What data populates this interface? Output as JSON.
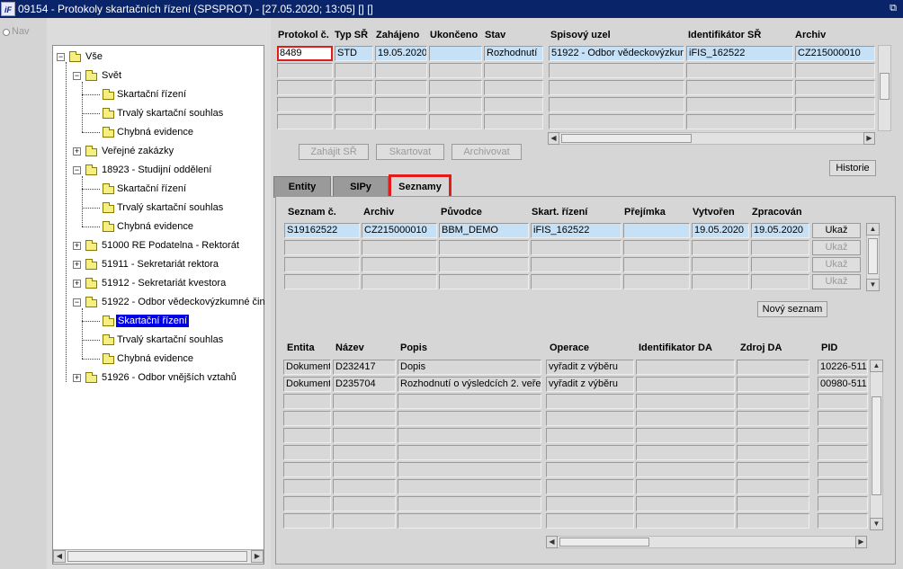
{
  "window": {
    "title": "09154 - Protokoly skartačních řízení (SPSPROT) - [27.05.2020; 13:05] [] []",
    "app_icon": "iF"
  },
  "nav": {
    "label": "Nav"
  },
  "tree": {
    "items": [
      {
        "label": "Vše"
      },
      {
        "label": "Svět"
      },
      {
        "label": "Skartační řízení"
      },
      {
        "label": "Trvalý skartační souhlas"
      },
      {
        "label": "Chybná evidence"
      },
      {
        "label": "Veřejné zakázky"
      },
      {
        "label": "18923 - Studijní oddělení"
      },
      {
        "label": "Skartační řízení"
      },
      {
        "label": "Trvalý skartační souhlas"
      },
      {
        "label": "Chybná evidence"
      },
      {
        "label": "51000 RE Podatelna - Rektorát"
      },
      {
        "label": "51911 - Sekretariát rektora"
      },
      {
        "label": "51912 - Sekretariát kvestora"
      },
      {
        "label": "51922 - Odbor vědeckovýzkumné čin"
      },
      {
        "label": "Skartační řízení"
      },
      {
        "label": "Trvalý skartační souhlas"
      },
      {
        "label": "Chybná evidence"
      },
      {
        "label": "51926 - Odbor vnějších vztahů"
      }
    ]
  },
  "protocol": {
    "headers": {
      "protokol": "Protokol č.",
      "typ": "Typ SŘ",
      "zahajeno": "Zahájeno",
      "ukonceno": "Ukončeno",
      "stav": "Stav",
      "uzel": "Spisový uzel",
      "ident": "Identifikátor SŘ",
      "archiv": "Archiv"
    },
    "row": {
      "protokol": "8489",
      "typ": "STD",
      "zahajeno": "19.05.2020",
      "ukonceno": "",
      "stav": "Rozhodnutí",
      "uzel": "51922 - Odbor vědeckovýzkun",
      "ident": "iFIS_162522",
      "archiv": "CZ215000010"
    }
  },
  "actions": {
    "zahajit": "Zahájit SŘ",
    "skartovat": "Skartovat",
    "archivovat": "Archivovat",
    "historie": "Historie"
  },
  "tabs": {
    "entity": "Entity",
    "sipy": "SIPy",
    "seznamy": "Seznamy"
  },
  "lists": {
    "headers": {
      "seznam": "Seznam č.",
      "archiv": "Archiv",
      "puvodce": "Původce",
      "skart": "Skart. řízení",
      "prejimka": "Přejímka",
      "vytvoren": "Vytvořen",
      "zpracovan": "Zpracován"
    },
    "row": {
      "seznam": "S19162522",
      "archiv": "CZ215000010",
      "puvodce": "BBM_DEMO",
      "skart": "iFIS_162522",
      "prejimka": "",
      "vytvoren": "19.05.2020",
      "zpracovan": "19.05.2020"
    },
    "show_label": "Ukaž",
    "new_list": "Nový seznam"
  },
  "entities": {
    "headers": {
      "entita": "Entita",
      "nazev": "Název",
      "popis": "Popis",
      "operace": "Operace",
      "ident": "Identifikator DA",
      "zdroj": "Zdroj DA",
      "pid": "PID"
    },
    "rows": [
      {
        "entita": "Dokument",
        "nazev": "D232417",
        "popis": "Dopis",
        "operace": "vyřadit z výběru",
        "ident": "",
        "zdroj": "",
        "pid": "10226-511"
      },
      {
        "entita": "Dokument",
        "nazev": "D235704",
        "popis": "Rozhodnutí o výsledcích 2. veře",
        "operace": "vyřadit z výběru",
        "ident": "",
        "zdroj": "",
        "pid": "00980-511"
      }
    ]
  }
}
